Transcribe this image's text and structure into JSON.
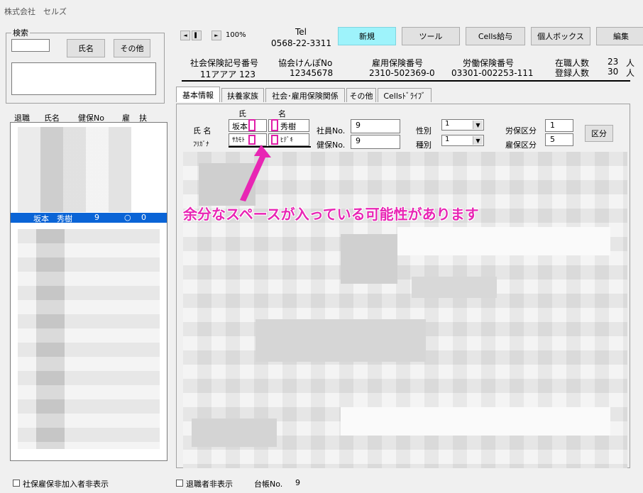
{
  "window": {
    "title": "株式会社　セルズ"
  },
  "search": {
    "legend": "検索",
    "name_button": "氏名",
    "other_button": "その他",
    "input_value": "",
    "memo_value": ""
  },
  "list": {
    "headers": [
      "退職",
      "氏名",
      "健保No",
      "雇",
      "扶"
    ],
    "selected_row": {
      "name": "坂本　秀樹",
      "kenpo": "9",
      "koyo": "○",
      "fuyo": "0"
    }
  },
  "nav": {
    "prev_label": "◄",
    "stop_label": "▌",
    "next_label": "►",
    "zoom": "100%"
  },
  "company": {
    "tel_label": "Tel",
    "tel": "0568-22-3311"
  },
  "toolbar": {
    "new": "新規",
    "tool": "ツール",
    "cells_salary": "Cells給与",
    "personal_box": "個人ボックス",
    "edit": "編集"
  },
  "insurance": {
    "social_label": "社会保険記号番号",
    "social_value": "11アアア 123",
    "kyokai_label": "協会けんぽNo",
    "kyokai_value": "12345678",
    "koyo_label": "雇用保険番号",
    "koyo_value": "2310-502369-0",
    "rodo_label": "労働保険番号",
    "rodo_value": "03301-002253-111",
    "zaishoku_label": "在職人数",
    "zaishoku_value": "23",
    "zaishoku_unit": "人",
    "toroku_label": "登録人数",
    "toroku_value": "30",
    "toroku_unit": "人"
  },
  "tabs": [
    "基本情報",
    "扶養家族",
    "社会･雇用保険関係",
    "その他",
    "Cellsﾄﾞﾗｲﾌﾞ"
  ],
  "form": {
    "sei_header": "氏",
    "mei_header": "名",
    "name_label": "氏 名",
    "kana_label": "ﾌﾘｶﾞﾅ",
    "sei": "坂本",
    "mei": "秀樹",
    "sei_kana": "ｻｶﾓﾄ",
    "mei_kana": "ﾋﾃﾞｷ",
    "shain_label": "社員No.",
    "shain_value": "9",
    "kenpo_label": "健保No.",
    "kenpo_value": "9",
    "seibetsu_label": "性別",
    "seibetsu_value": "1",
    "shubetsu_label": "種別",
    "shubetsu_value": "1",
    "rouho_label": "労保区分",
    "rouho_value": "1",
    "koho_label": "雇保区分",
    "koho_value": "5",
    "kubun_button": "区分"
  },
  "annotation": {
    "text": "余分なスペースが入っている可能性があります",
    "color": "#e826b4"
  },
  "footer": {
    "hide_non_members": "社保雇保非加入者非表示",
    "hide_retired": "退職者非表示",
    "ledger_label": "台帳No.",
    "ledger_value": "9"
  }
}
